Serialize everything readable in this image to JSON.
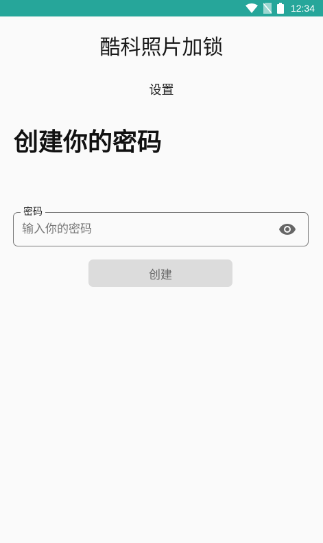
{
  "status_bar": {
    "time": "12:34",
    "icons": [
      "wifi-icon",
      "no-sim-icon",
      "battery-icon"
    ],
    "color": "#26a69a"
  },
  "app": {
    "title": "酷科照片加锁",
    "subtitle": "设置"
  },
  "form": {
    "heading": "创建你的密码",
    "password_label": "密码",
    "password_placeholder": "输入你的密码",
    "password_value": "",
    "toggle_icon": "eye-icon",
    "create_label": "创建"
  }
}
